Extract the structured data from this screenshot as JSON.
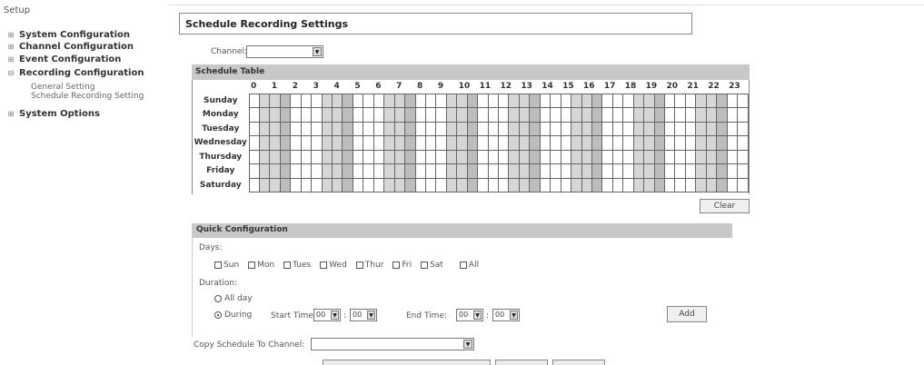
{
  "sidebar": {
    "title": "Setup",
    "items": [
      {
        "icon": "plus-icon",
        "label": "System Configuration"
      },
      {
        "icon": "plus-icon",
        "label": "Channel Configuration"
      },
      {
        "icon": "plus-icon",
        "label": "Event Configuration"
      },
      {
        "icon": "minus-icon",
        "label": "Recording Configuration"
      }
    ],
    "sub_items": [
      "General Setting",
      "Schedule Recording Setting"
    ],
    "last_item": {
      "icon": "plus-icon",
      "label": "System Options"
    }
  },
  "page": {
    "title": "Schedule Recording Settings",
    "channel_label": "Channel:",
    "channel_value": ""
  },
  "schedule": {
    "header": "Schedule Table",
    "hours": [
      "0",
      "1",
      "2",
      "3",
      "4",
      "5",
      "6",
      "7",
      "8",
      "9",
      "10",
      "11",
      "12",
      "13",
      "14",
      "15",
      "16",
      "17",
      "18",
      "19",
      "20",
      "21",
      "22",
      "23"
    ],
    "days": [
      "Sunday",
      "Monday",
      "Tuesday",
      "Wednesday",
      "Thursday",
      "Friday",
      "Saturday"
    ],
    "clear_label": "Clear"
  },
  "quick": {
    "header": "Quick Configuration",
    "days_label": "Days:",
    "day_options": [
      "Sun",
      "Mon",
      "Tues",
      "Wed",
      "Thur",
      "Fri",
      "Sat",
      "All"
    ],
    "duration_label": "Duration:",
    "all_day_label": "All day",
    "during_label": "During",
    "start_time_label": "Start Time:",
    "start_hour": "00",
    "start_min": "00",
    "end_time_label": "End Time:",
    "end_hour": "00",
    "end_min": "00",
    "time_sep": ":",
    "add_label": "Add"
  },
  "copy": {
    "label": "Copy Schedule To Channel:",
    "value": ""
  }
}
